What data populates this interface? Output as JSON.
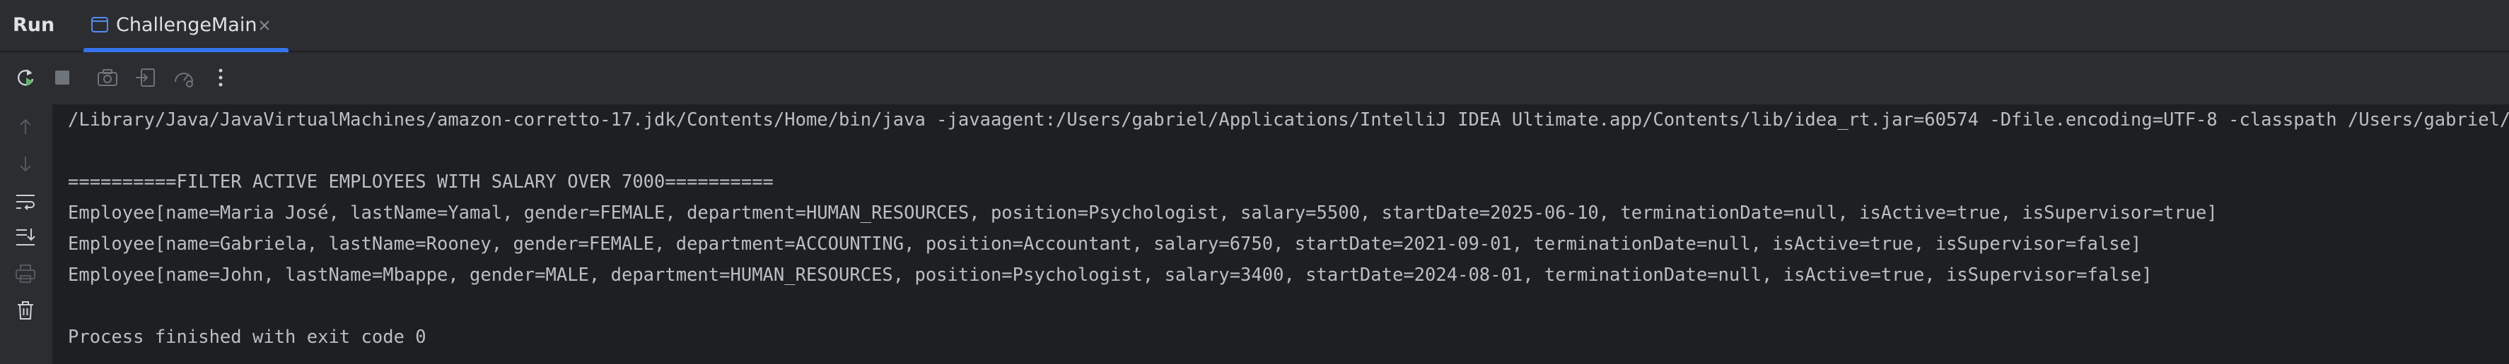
{
  "header": {
    "panel_title": "Run",
    "tab_label": "ChallengeMain"
  },
  "console": {
    "lines": [
      "/Library/Java/JavaVirtualMachines/amazon-corretto-17.jdk/Contents/Home/bin/java -javaagent:/Users/gabriel/Applications/IntelliJ IDEA Ultimate.app/Contents/lib/idea_rt.jar=60574 -Dfile.encoding=UTF-8 -classpath /Users/gabriel/",
      "",
      "==========FILTER ACTIVE EMPLOYEES WITH SALARY OVER 7000==========",
      "Employee[name=Maria José, lastName=Yamal, gender=FEMALE, department=HUMAN_RESOURCES, position=Psychologist, salary=5500, startDate=2025-06-10, terminationDate=null, isActive=true, isSupervisor=true]",
      "Employee[name=Gabriela, lastName=Rooney, gender=FEMALE, department=ACCOUNTING, position=Accountant, salary=6750, startDate=2021-09-01, terminationDate=null, isActive=true, isSupervisor=false]",
      "Employee[name=John, lastName=Mbappe, gender=MALE, department=HUMAN_RESOURCES, position=Psychologist, salary=3400, startDate=2024-08-01, terminationDate=null, isActive=true, isSupervisor=false]",
      "",
      "Process finished with exit code 0"
    ]
  },
  "icons": {
    "toolbar": [
      "rerun-icon",
      "stop-icon",
      "camera-icon",
      "restore-layout-icon",
      "profiler-icon",
      "more-icon"
    ],
    "sidebar": [
      "scroll-up-icon",
      "scroll-down-icon",
      "soft-wrap-icon",
      "scroll-to-end-icon",
      "print-icon",
      "clear-icon"
    ]
  },
  "colors": {
    "accent": "#3574f0",
    "panel_bg": "#2b2d30",
    "console_bg": "#1e1f22",
    "console_text": "#bcbec4",
    "rerun_green": "#5fb865"
  }
}
